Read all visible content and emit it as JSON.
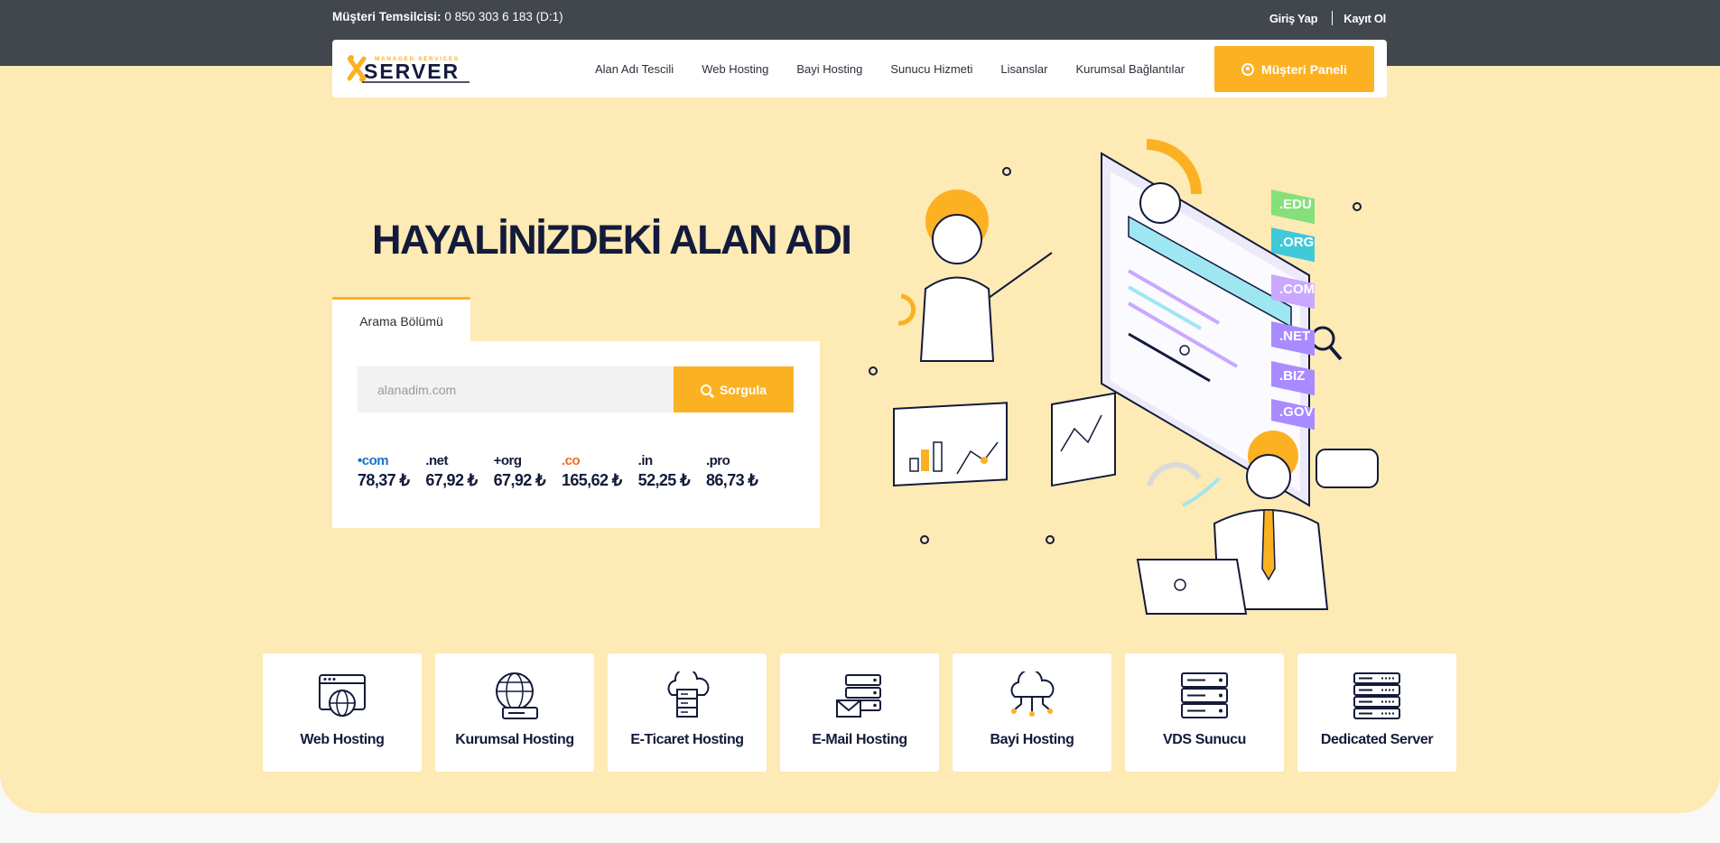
{
  "topbar": {
    "rep_label": "Müşteri Temsilcisi:",
    "rep_phone": "0 850 303 6 183 (D:1)",
    "login": "Giriş Yap",
    "register": "Kayıt Ol"
  },
  "brand": {
    "logo_top": "MANAGED SERVICES",
    "logo_main": "SERVER",
    "accent": "#fbb122",
    "dark": "#42464d",
    "hero_bg": "#fdeab4"
  },
  "nav": {
    "items": [
      "Alan Adı Tescili",
      "Web Hosting",
      "Bayi Hosting",
      "Sunucu Hizmeti",
      "Lisanslar",
      "Kurumsal Bağlantılar"
    ],
    "panel_button": "Müşteri Paneli"
  },
  "hero": {
    "headline": "HAYALİNİZDEKİ ALAN ADI",
    "tab": "Arama Bölümü",
    "search_placeholder": "alanadim.com",
    "search_button": "Sorgula",
    "prices": [
      {
        "ext": "•com",
        "price": "78,37 ₺",
        "color": "#1a73c9"
      },
      {
        "ext": ".net",
        "price": "67,92 ₺",
        "color": "#131a3b"
      },
      {
        "ext": "+org",
        "price": "67,92 ₺",
        "color": "#131a3b"
      },
      {
        "ext": ".co",
        "price": "165,62 ₺",
        "color": "#f26a21"
      },
      {
        "ext": ".in",
        "price": "52,25 ₺",
        "color": "#131a3b"
      },
      {
        "ext": ".pro",
        "price": "86,73 ₺",
        "color": "#131a3b"
      }
    ],
    "illustration_tags": [
      ".EDU",
      ".ORG",
      ".COM",
      ".NET",
      ".BIZ",
      ".GOV"
    ]
  },
  "services": [
    {
      "label": "Web Hosting",
      "icon": "browser-globe-icon"
    },
    {
      "label": "Kurumsal Hosting",
      "icon": "globe-server-icon"
    },
    {
      "label": "E-Ticaret Hosting",
      "icon": "cloud-server-icon"
    },
    {
      "label": "E-Mail Hosting",
      "icon": "mail-server-icon"
    },
    {
      "label": "Bayi Hosting",
      "icon": "cloud-network-icon"
    },
    {
      "label": "VDS Sunucu",
      "icon": "server-rack-icon"
    },
    {
      "label": "Dedicated Server",
      "icon": "dedicated-rack-icon"
    }
  ]
}
